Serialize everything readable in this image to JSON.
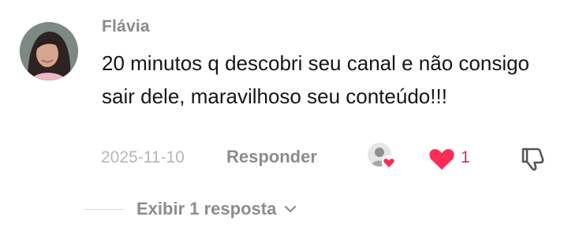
{
  "comment": {
    "username": "Flávia",
    "text": "20 minutos q descobri seu canal e não consigo sair dele, maravilhoso seu conteúdo!!!",
    "date": "2025-11-10",
    "reply_label": "Responder",
    "like_count": "1",
    "view_replies_label": "Exibir 1 resposta"
  },
  "icons": {
    "avatar": "user-avatar",
    "creator_liked": "creator-liked-avatar-heart-icon",
    "like": "heart-icon",
    "dislike": "thumbs-down-icon",
    "expand": "chevron-down-icon"
  },
  "colors": {
    "like_red": "#e0245e",
    "muted_text": "#8c8c8c",
    "date_text": "#b6b6b6",
    "body_text": "#161616"
  }
}
